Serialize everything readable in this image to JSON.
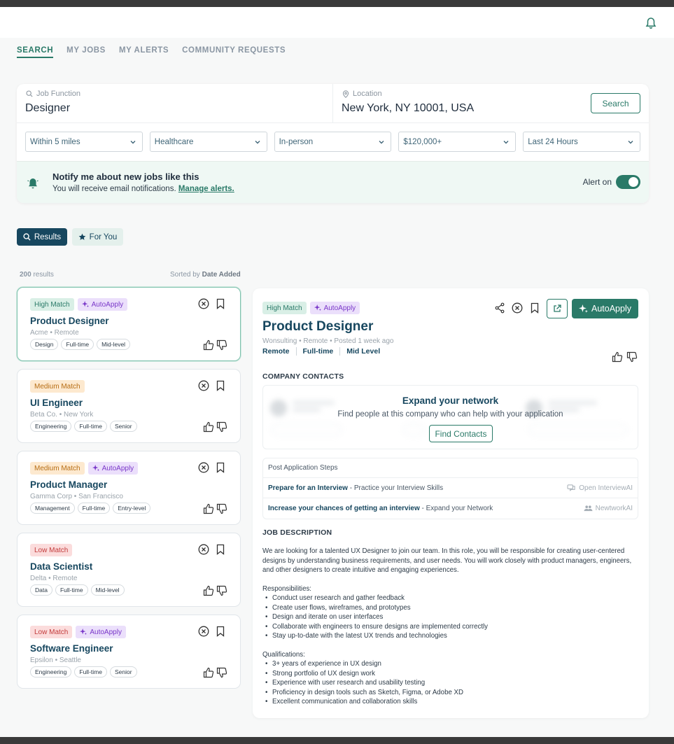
{
  "nav": {
    "tabs": [
      {
        "label": "SEARCH",
        "active": true
      },
      {
        "label": "MY JOBS"
      },
      {
        "label": "MY ALERTS"
      },
      {
        "label": "COMMUNITY REQUESTS"
      }
    ]
  },
  "search": {
    "job_function_label": "Job Function",
    "job_function_value": "Designer",
    "location_label": "Location",
    "location_value": "New York, NY 10001, USA",
    "button": "Search",
    "filters": [
      "Within 5 miles",
      "Healthcare",
      "In-person",
      "$120,000+",
      "Last 24 Hours"
    ]
  },
  "alert": {
    "title": "Notify me about new jobs like this",
    "subtitle": "You will receive email notifications.",
    "link": "Manage alerts.",
    "toggle_label": "Alert on"
  },
  "tabs": {
    "results": "Results",
    "for_you": "For You"
  },
  "results": {
    "count_number": "200",
    "count_suffix": " results",
    "sorted_prefix": "Sorted by ",
    "sorted_value": "Date Added"
  },
  "jobs": [
    {
      "match": "High Match",
      "autoapply": "AutoApply",
      "title": "Product Designer",
      "meta": "Acme • Remote",
      "tags": [
        "Design",
        "Full-time",
        "Mid-level"
      ]
    },
    {
      "match": "Medium Match",
      "title": "UI Engineer",
      "meta": "Beta Co. • New York",
      "tags": [
        "Engineering",
        "Full-time",
        "Senior"
      ]
    },
    {
      "match": "Medium Match",
      "autoapply": "AutoApply",
      "title": "Product Manager",
      "meta": "Gamma Corp • San Francisco",
      "tags": [
        "Management",
        "Full-time",
        "Entry-level"
      ]
    },
    {
      "match": "Low Match",
      "title": "Data Scientist",
      "meta": "Delta • Remote",
      "tags": [
        "Data",
        "Full-time",
        "Mid-level"
      ]
    },
    {
      "match": "Low Match",
      "autoapply": "AutoApply",
      "title": "Software Engineer",
      "meta": "Epsilon • Seattle",
      "tags": [
        "Engineering",
        "Full-time",
        "Senior"
      ]
    }
  ],
  "detail": {
    "match": "High Match",
    "autoapply_badge": "AutoApply",
    "autoapply_button": "AutoApply",
    "title": "Product Designer",
    "meta": "Wonsulting • Remote • Posted 1 week ago",
    "attrs": [
      "Remote",
      "Full-time",
      "Mid Level"
    ],
    "contacts_heading": "COMPANY CONTACTS",
    "network_title": "Expand your network",
    "network_sub": "Find people at this company who can help with your application",
    "find_contacts": "Find Contacts",
    "steps_heading": "Post Application Steps",
    "steps": [
      {
        "bold": "Prepare for an Interview",
        "rest": " - Practice your Interview Skills",
        "action": "Open InterviewAI",
        "icon": "chat-icon"
      },
      {
        "bold": "Increase your chances of getting an interview",
        "rest": " - Expand your Network",
        "action": "NewtworkAI",
        "icon": "people-icon"
      }
    ],
    "desc_heading": "JOB DESCRIPTION",
    "intro": "We are looking for a talented UX Designer to join our team. In this role, you will be responsible for creating user-centered designs by understanding business requirements, and user needs. You will work closely with product managers, engineers, and other designers to create intuitive and engaging experiences.",
    "resp_heading": "Responsibilities:",
    "responsibilities": [
      "Conduct user research and gather feedback",
      "Create user flows, wireframes, and prototypes",
      "Design and iterate on user interfaces",
      "Collaborate with engineers to ensure designs are implemented correctly",
      "Stay up-to-date with the latest UX trends and technologies"
    ],
    "qual_heading": "Qualifications:",
    "qualifications": [
      "3+ years of experience in UX design",
      "Strong portfolio of UX design work",
      "Experience with user research and usability testing",
      "Proficiency in design tools such as Sketch, Figma, or Adobe XD",
      "Excellent communication and collaboration skills"
    ]
  },
  "colors": {
    "accent": "#2a7a68",
    "navy": "#17475f",
    "high": "#d9efe6",
    "medium": "#fde9cf",
    "low": "#fbdcdc",
    "auto": "#ebdffb"
  }
}
